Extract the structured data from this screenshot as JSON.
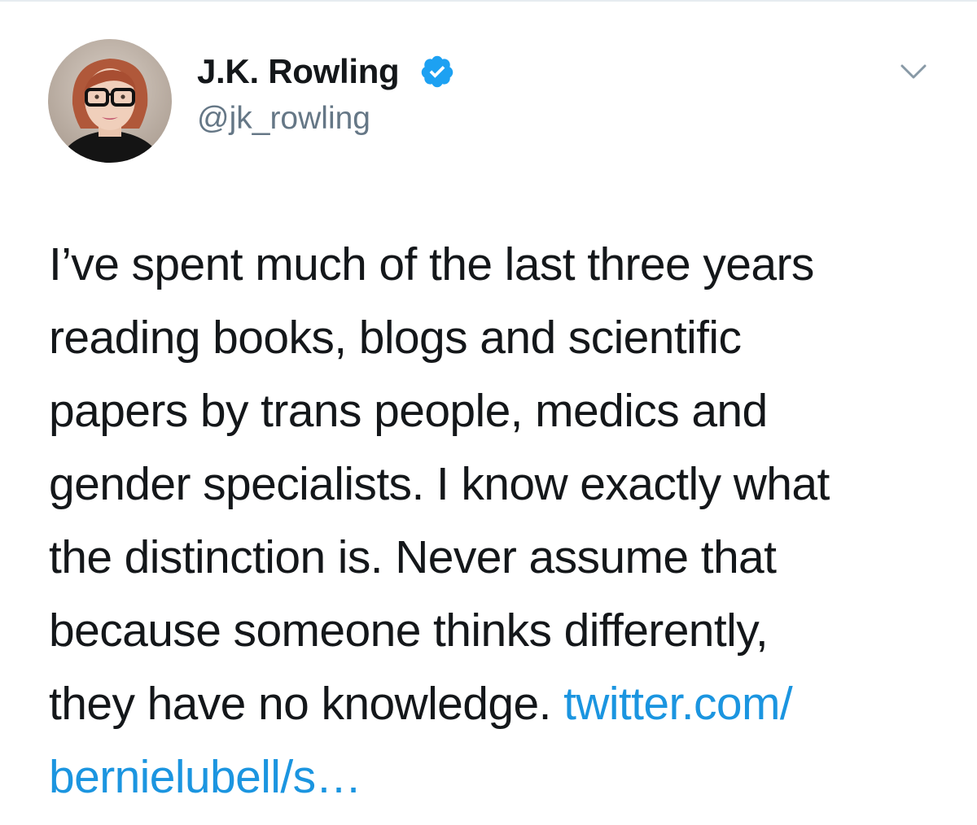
{
  "tweet": {
    "author": {
      "name": "J.K. Rowling",
      "handle": "@jk_rowling",
      "verified": true,
      "avatar_icon": "profile-photo-icon"
    },
    "menu_icon": "chevron-down-icon",
    "text_lines": [
      "I’ve spent much of the last three years",
      "reading books, blogs and scientific",
      "papers by trans people, medics and",
      "gender specialists. I know exactly what",
      "the distinction is. Never assume that",
      "because someone thinks differently,",
      "they have no knowledge. "
    ],
    "link_part_1": "twitter.com/",
    "link_part_2": "bernielubell/s…"
  },
  "colors": {
    "text": "#14171a",
    "handle": "#657786",
    "link": "#1b95e0",
    "verified_badge": "#1da1f2",
    "caret": "#8899a6",
    "divider": "#e6ecf0"
  }
}
